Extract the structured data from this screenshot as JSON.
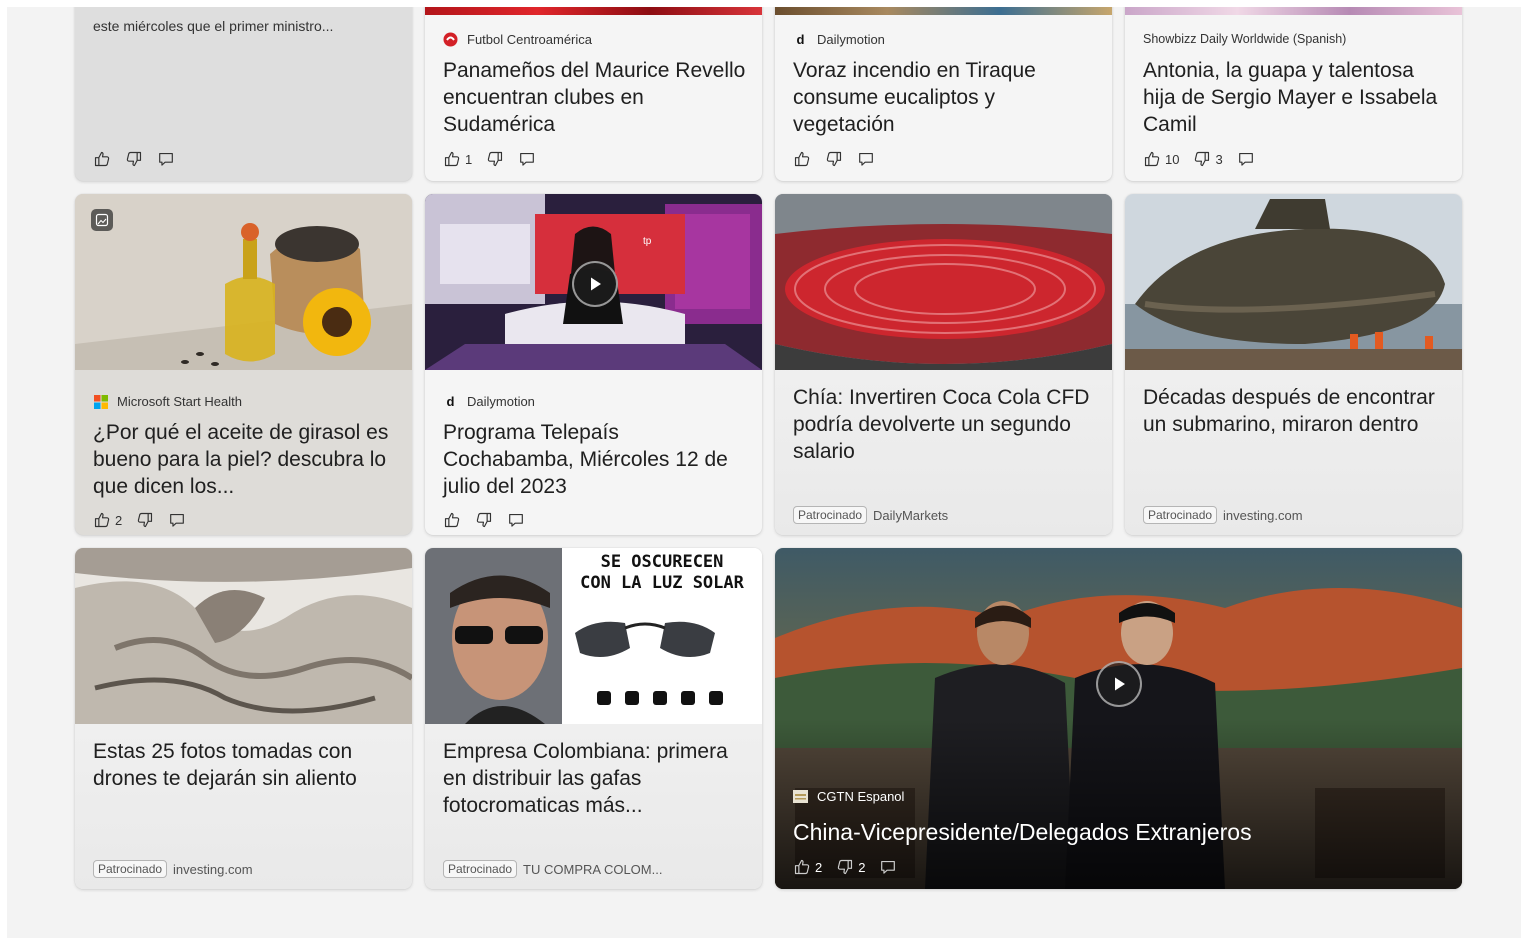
{
  "colors": {
    "page_bg": "#f3f3f3",
    "card_bg": "#f5f5f5",
    "text": "#202020"
  },
  "cards": {
    "c1": {
      "title": "este miércoles que el primer ministro..."
    },
    "c2": {
      "source": "Futbol Centroamérica",
      "title": "Panameños del Maurice Revello encuentran clubes en Sudamérica",
      "likes": "1"
    },
    "c3": {
      "source": "Dailymotion",
      "title": "Voraz incendio en Tiraque consume eucaliptos y vegetación"
    },
    "c4": {
      "source": "Showbizz Daily Worldwide (Spanish)",
      "title": "Antonia, la guapa y talentosa hija de Sergio Mayer e Issabela Camil",
      "likes": "10",
      "dislikes": "3"
    },
    "c5": {
      "source": "Microsoft Start Health",
      "title": "¿Por qué el aceite de girasol es bueno para la piel? descubra lo que dicen los...",
      "likes": "2"
    },
    "c6": {
      "source": "Dailymotion",
      "title": "Programa Telepaís Cochabamba, Miércoles 12 de julio del 2023",
      "tv_text": "tp"
    },
    "c7": {
      "title": "Chía: Invertiren Coca Cola CFD podría devolverte un segundo salario",
      "badge": "Patrocinado",
      "sponsor": "DailyMarkets"
    },
    "c8": {
      "title": "Décadas después de encontrar un submarino, miraron dentro",
      "badge": "Patrocinado",
      "sponsor": "investing.com"
    },
    "c9": {
      "title": "Estas 25 fotos tomadas con drones te dejarán sin aliento",
      "badge": "Patrocinado",
      "sponsor": "investing.com"
    },
    "c10": {
      "title": "Empresa Colombiana: primera en distribuir las gafas fotocromaticas más...",
      "badge": "Patrocinado",
      "sponsor": "TU COMPRA COLOM...",
      "ad_line1": "SE OSCURECEN",
      "ad_line2": "CON LA LUZ SOLAR"
    },
    "c11": {
      "source": "CGTN Espanol",
      "title": "China-Vicepresidente/Delegados Extranjeros",
      "likes": "2",
      "dislikes": "2"
    }
  }
}
